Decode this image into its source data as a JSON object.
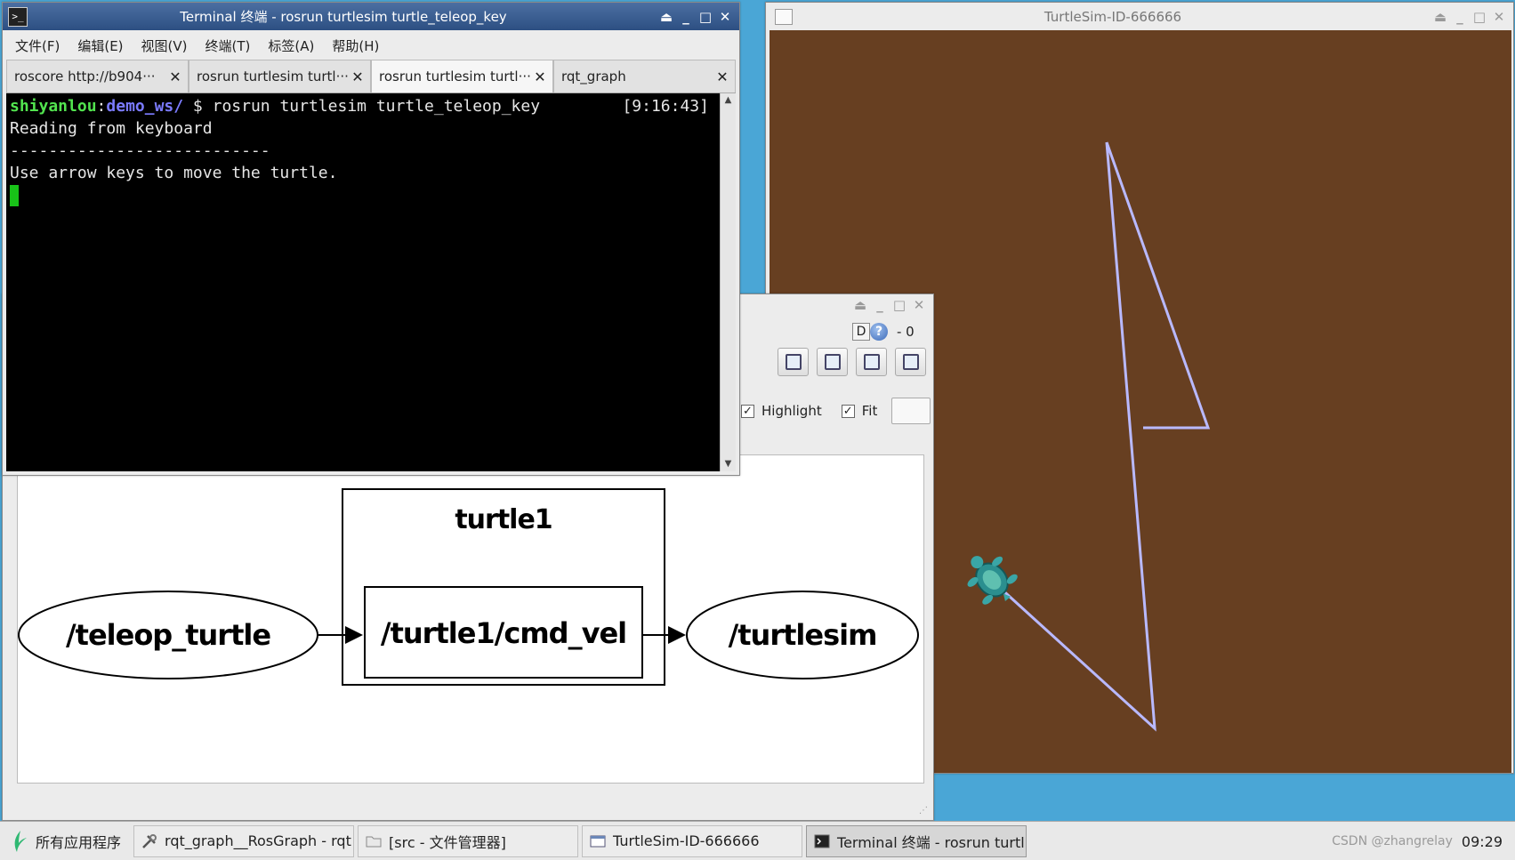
{
  "terminal": {
    "title": "Terminal 终端 - rosrun turtlesim turtle_teleop_key",
    "menu": [
      "文件(F)",
      "编辑(E)",
      "视图(V)",
      "终端(T)",
      "标签(A)",
      "帮助(H)"
    ],
    "tabs": [
      {
        "label": "roscore http://b904···",
        "active": false
      },
      {
        "label": "rosrun turtlesim turtl···",
        "active": false
      },
      {
        "label": "rosrun turtlesim turtl···",
        "active": true
      },
      {
        "label": "rqt_graph",
        "active": false
      }
    ],
    "prompt_user": "shiyanlou",
    "prompt_sep": ":",
    "prompt_path": "demo_ws/",
    "prompt_cmd": " $ rosrun turtlesim turtle_teleop_key",
    "prompt_time": "[9:16:43]",
    "output": [
      "Reading from keyboard",
      "---------------------------",
      "Use arrow keys to move the turtle."
    ]
  },
  "turtlesim": {
    "title": "TurtleSim-ID-666666",
    "background_color": "#673f21",
    "pen_color": "#b9b9ff"
  },
  "rqt": {
    "d_label": "D",
    "help_symbol": "?",
    "counter": "- 0",
    "highlight_label": "Highlight",
    "fit_label": "Fit",
    "graph": {
      "nodes": [
        "/teleop_turtle",
        "/turtlesim"
      ],
      "namespace": "turtle1",
      "topic": "/turtle1/cmd_vel"
    }
  },
  "taskbar": {
    "start_label": "所有应用程序",
    "items": [
      {
        "label": "rqt_graph__RosGraph - rqt",
        "icon": "tools-icon",
        "active": false
      },
      {
        "label": "[src - 文件管理器]",
        "icon": "folder-icon",
        "active": false
      },
      {
        "label": "TurtleSim-ID-666666",
        "icon": "window-icon",
        "active": false
      },
      {
        "label": "Terminal 终端 - rosrun turtl···",
        "icon": "terminal-icon",
        "active": true
      }
    ],
    "clock": "09:29",
    "watermark": "CSDN @zhangrelay"
  }
}
